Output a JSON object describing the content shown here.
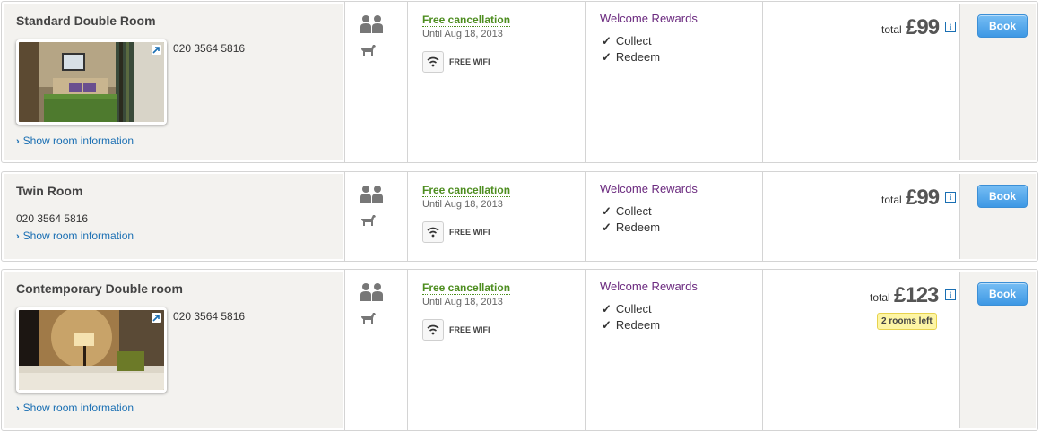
{
  "colors": {
    "link": "#1a6fb3",
    "cancellation_green": "#4d8d1f",
    "rewards_purple": "#6b2a7f",
    "book_button": "#3d98e4",
    "badge_yellow": "#fdf5a4",
    "panel_bg": "#f3f2ef"
  },
  "rooms": [
    {
      "name": "Standard Double Room",
      "phone": "020 3564 5816",
      "has_photo": true,
      "show_info_label": "Show room information",
      "occupancy_icons": [
        "two-adults-icon",
        "pet-dog-icon"
      ],
      "cancellation": {
        "label": "Free cancellation",
        "until": "Until Aug 18, 2013"
      },
      "amenity": {
        "icon": "wifi-icon",
        "label": "FREE WIFI"
      },
      "rewards": {
        "title": "Welcome Rewards",
        "items": [
          "Collect",
          "Redeem"
        ]
      },
      "price": {
        "total_label": "total",
        "amount": "£99"
      },
      "book_label": "Book"
    },
    {
      "name": "Twin Room",
      "phone": "020 3564 5816",
      "has_photo": false,
      "show_info_label": "Show room information",
      "occupancy_icons": [
        "two-adults-icon",
        "pet-dog-icon"
      ],
      "cancellation": {
        "label": "Free cancellation",
        "until": "Until Aug 18, 2013"
      },
      "amenity": {
        "icon": "wifi-icon",
        "label": "FREE WIFI"
      },
      "rewards": {
        "title": "Welcome Rewards",
        "items": [
          "Collect",
          "Redeem"
        ]
      },
      "price": {
        "total_label": "total",
        "amount": "£99"
      },
      "book_label": "Book"
    },
    {
      "name": "Contemporary Double room",
      "phone": "020 3564 5816",
      "has_photo": true,
      "show_info_label": "Show room information",
      "occupancy_icons": [
        "two-adults-icon",
        "pet-dog-icon"
      ],
      "cancellation": {
        "label": "Free cancellation",
        "until": "Until Aug 18, 2013"
      },
      "amenity": {
        "icon": "wifi-icon",
        "label": "FREE WIFI"
      },
      "rewards": {
        "title": "Welcome Rewards",
        "items": [
          "Collect",
          "Redeem"
        ]
      },
      "price": {
        "total_label": "total",
        "amount": "£123",
        "availability_badge": "2 rooms left"
      },
      "book_label": "Book"
    }
  ]
}
